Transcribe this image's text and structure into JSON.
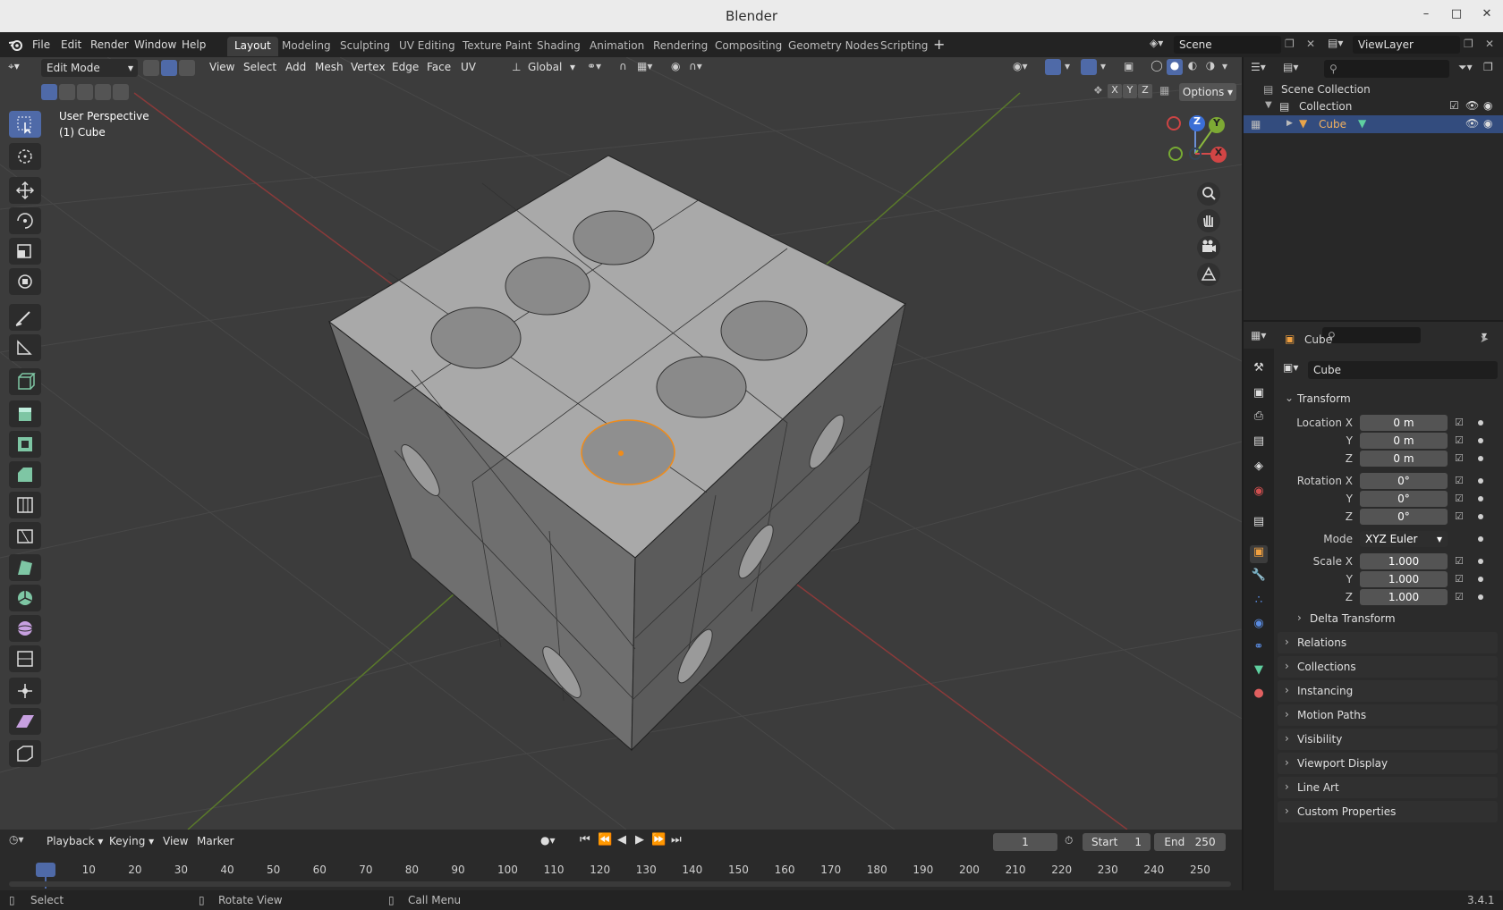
{
  "window": {
    "title": "Blender"
  },
  "menu": [
    "File",
    "Edit",
    "Render",
    "Window",
    "Help"
  ],
  "workspaces": [
    "Layout",
    "Modeling",
    "Sculpting",
    "UV Editing",
    "Texture Paint",
    "Shading",
    "Animation",
    "Rendering",
    "Compositing",
    "Geometry Nodes",
    "Scripting"
  ],
  "active_workspace": "Layout",
  "scene": {
    "name": "Scene",
    "view_layer": "ViewLayer"
  },
  "viewport": {
    "mode": "Edit Mode",
    "menus": [
      "View",
      "Select",
      "Add",
      "Mesh",
      "Vertex",
      "Edge",
      "Face",
      "UV"
    ],
    "orientation": "Global",
    "perspective_label": "User Perspective",
    "object_label": "(1) Cube",
    "axis_toggles": [
      "X",
      "Y",
      "Z"
    ],
    "options_label": "Options",
    "gizmo": {
      "x": "X",
      "y": "Y",
      "z": "Z"
    }
  },
  "tools": [
    "select-box-icon",
    "cursor-icon",
    "move-icon",
    "rotate-icon",
    "scale-icon",
    "transform-icon",
    "annotate-icon",
    "measure-icon",
    "add-cube-icon",
    "extrude-icon",
    "inset-icon",
    "bevel-icon",
    "loop-cut-icon",
    "knife-icon",
    "poly-build-icon",
    "spin-icon",
    "smooth-icon",
    "edge-slide-icon",
    "shrink-fatten-icon",
    "shear-icon",
    "rip-icon"
  ],
  "outliner": {
    "scene_collection": "Scene Collection",
    "collection": "Collection",
    "object": "Cube"
  },
  "properties": {
    "object_name": "Cube",
    "object_field": "Cube",
    "transform_label": "Transform",
    "location_label": "Location X",
    "rotation_label": "Rotation X",
    "scale_label": "Scale X",
    "y_label": "Y",
    "z_label": "Z",
    "location": [
      "0 m",
      "0 m",
      "0 m"
    ],
    "rotation": [
      "0°",
      "0°",
      "0°"
    ],
    "mode_label": "Mode",
    "mode_value": "XYZ Euler",
    "scale": [
      "1.000",
      "1.000",
      "1.000"
    ],
    "delta_transform": "Delta Transform",
    "panels": [
      "Relations",
      "Collections",
      "Instancing",
      "Motion Paths",
      "Visibility",
      "Viewport Display",
      "Line Art",
      "Custom Properties"
    ]
  },
  "timeline": {
    "menus": [
      "Playback",
      "Keying",
      "View",
      "Marker"
    ],
    "current_frame": "1",
    "start_label": "Start",
    "start": "1",
    "end_label": "End",
    "end": "250",
    "ruler": [
      "1",
      "10",
      "20",
      "30",
      "40",
      "50",
      "60",
      "70",
      "80",
      "90",
      "100",
      "110",
      "120",
      "130",
      "140",
      "150",
      "160",
      "170",
      "180",
      "190",
      "200",
      "210",
      "220",
      "230",
      "240",
      "250"
    ]
  },
  "statusbar": {
    "select": "Select",
    "rotate": "Rotate View",
    "call_menu": "Call Menu",
    "version": "3.4.1"
  }
}
